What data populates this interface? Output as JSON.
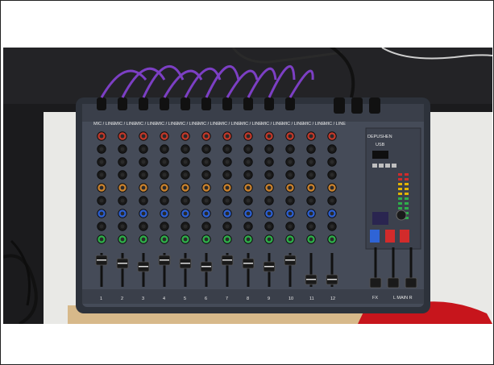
{
  "scene": {
    "subject": "audio mixing console",
    "colors": {
      "background": "#1b1b1d",
      "table": "#e9e9e6",
      "mixer_body": "#3a3f4a",
      "mixer_panel": "#454b58",
      "cables": "#7c3fc4",
      "knob_red": "#c0392b",
      "knob_blue": "#2c5fd1",
      "knob_green": "#2fae4a",
      "knob_orange": "#c9822f",
      "button_blue": "#2f64d6",
      "button_red": "#d22b2b",
      "cloth": "#c7151c"
    }
  },
  "mixer": {
    "channel_header": "MIC / LINE",
    "brand": "DEPUSHEN",
    "fx_label": "FX",
    "mains_label": "L MAIN R",
    "usb_label": "USB",
    "channel_numbers": [
      "1",
      "2",
      "3",
      "4",
      "5",
      "6",
      "7",
      "8",
      "9",
      "10",
      "11",
      "12"
    ]
  }
}
